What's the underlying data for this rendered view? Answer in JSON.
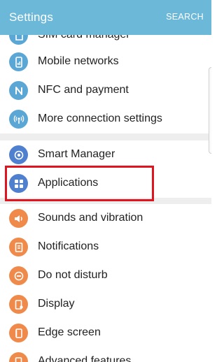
{
  "header": {
    "title": "Settings",
    "search_label": "SEARCH",
    "color": "#6cb8d8"
  },
  "groups": [
    {
      "items": [
        {
          "label": "SIM card manager",
          "icon": "sim-card-icon",
          "color": "#5aa7d6"
        },
        {
          "label": "Mobile networks",
          "icon": "mobile-network-icon",
          "color": "#5aa7d6"
        },
        {
          "label": "NFC and payment",
          "icon": "nfc-icon",
          "color": "#5aa7d6"
        },
        {
          "label": "More connection settings",
          "icon": "connection-icon",
          "color": "#5aa7d6"
        }
      ]
    },
    {
      "items": [
        {
          "label": "Smart Manager",
          "icon": "smart-manager-icon",
          "color": "#4f7fcf"
        },
        {
          "label": "Applications",
          "icon": "applications-icon",
          "color": "#4f7fcf",
          "highlighted": true
        }
      ]
    },
    {
      "items": [
        {
          "label": "Sounds and vibration",
          "icon": "speaker-icon",
          "color": "#f08a4b"
        },
        {
          "label": "Notifications",
          "icon": "notification-icon",
          "color": "#f08a4b"
        },
        {
          "label": "Do not disturb",
          "icon": "do-not-disturb-icon",
          "color": "#f08a4b"
        },
        {
          "label": "Display",
          "icon": "display-icon",
          "color": "#f08a4b"
        },
        {
          "label": "Edge screen",
          "icon": "edge-screen-icon",
          "color": "#f08a4b"
        },
        {
          "label": "Advanced features",
          "icon": "advanced-features-icon",
          "color": "#f08a4b"
        }
      ]
    }
  ],
  "highlight_color": "#e0141e"
}
